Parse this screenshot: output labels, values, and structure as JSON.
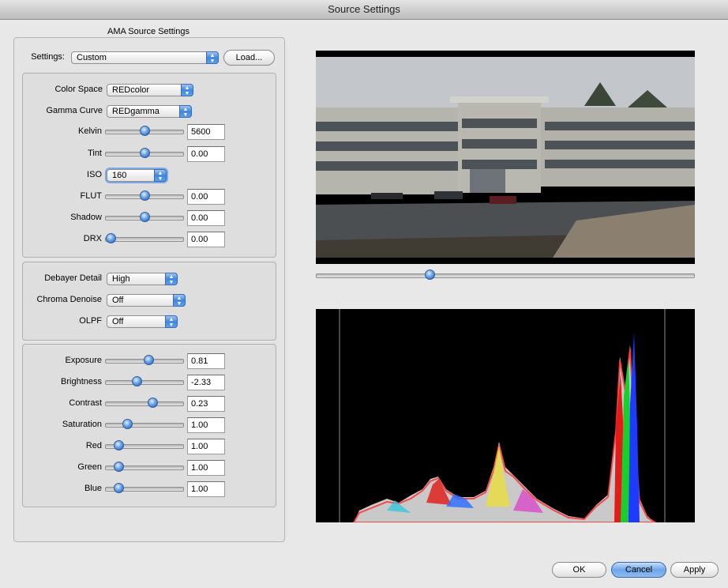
{
  "window": {
    "title": "Source Settings"
  },
  "ama": {
    "title": "AMA Source Settings",
    "settings_label": "Settings:",
    "settings_value": "Custom",
    "load_button": "Load..."
  },
  "color": {
    "color_space_label": "Color Space",
    "color_space_value": "REDcolor",
    "gamma_label": "Gamma Curve",
    "gamma_value": "REDgamma",
    "kelvin_label": "Kelvin",
    "kelvin_value": "5600",
    "kelvin_level": 0.5,
    "tint_label": "Tint",
    "tint_value": "0.00",
    "tint_level": 0.5,
    "iso_label": "ISO",
    "iso_value": "160",
    "flut_label": "FLUT",
    "flut_value": "0.00",
    "flut_level": 0.5,
    "shadow_label": "Shadow",
    "shadow_value": "0.00",
    "shadow_level": 0.5,
    "drx_label": "DRX",
    "drx_value": "0.00",
    "drx_level": 0.07
  },
  "debayer": {
    "detail_label": "Debayer Detail",
    "detail_value": "High",
    "denoise_label": "Chroma Denoise",
    "denoise_value": "Off",
    "olpf_label": "OLPF",
    "olpf_value": "Off"
  },
  "adjust": {
    "exposure_label": "Exposure",
    "exposure_value": "0.81",
    "exposure_level": 0.55,
    "brightness_label": "Brightness",
    "brightness_value": "-2.33",
    "brightness_level": 0.4,
    "contrast_label": "Contrast",
    "contrast_value": "0.23",
    "contrast_level": 0.6,
    "saturation_label": "Saturation",
    "saturation_value": "1.00",
    "saturation_level": 0.28,
    "red_label": "Red",
    "red_value": "1.00",
    "red_level": 0.17,
    "green_label": "Green",
    "green_value": "1.00",
    "green_level": 0.17,
    "blue_label": "Blue",
    "blue_value": "1.00",
    "blue_level": 0.17
  },
  "preview": {
    "scrub_level": 0.3
  },
  "footer": {
    "ok": "OK",
    "cancel": "Cancel",
    "apply": "Apply"
  }
}
